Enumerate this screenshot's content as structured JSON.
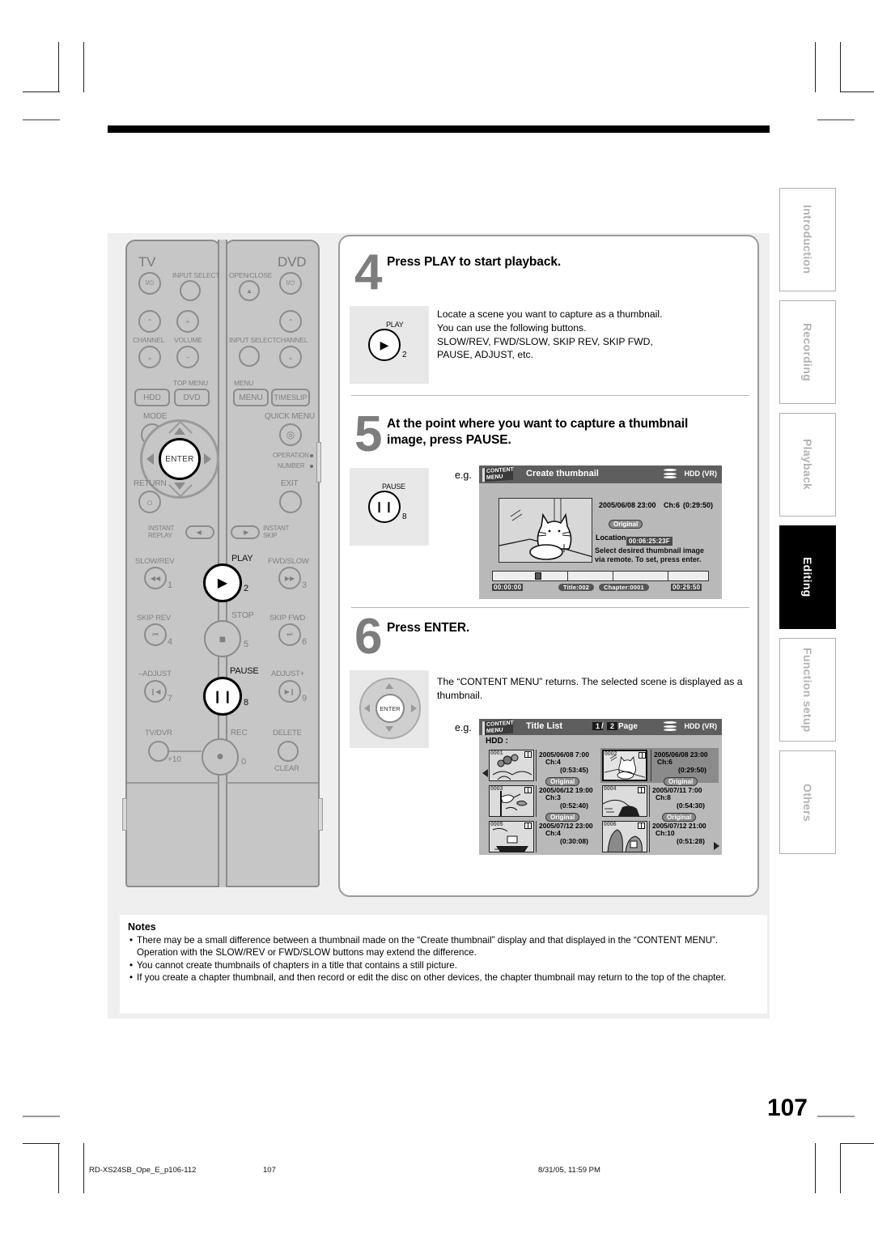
{
  "page": {
    "number": "107",
    "footer_file": "RD-XS24SB_Ope_E_p106-112",
    "footer_page": "107",
    "footer_date": "8/31/05, 11:59 PM"
  },
  "side_tabs": [
    {
      "label": "Introduction",
      "active": false
    },
    {
      "label": "Recording",
      "active": false
    },
    {
      "label": "Playback",
      "active": false
    },
    {
      "label": "Editing",
      "active": true
    },
    {
      "label": "Function setup",
      "active": false
    },
    {
      "label": "Others",
      "active": false
    }
  ],
  "steps": [
    {
      "number": "4",
      "heading": "Press PLAY to start playback.",
      "key_label": "PLAY",
      "key_number": "2",
      "key_icon": "play-icon",
      "body": "Locate a scene you want to capture as a thumbnail.\nYou can use the following buttons.\nSLOW/REV, FWD/SLOW, SKIP REV, SKIP FWD,\nPAUSE, ADJUST, etc."
    },
    {
      "number": "5",
      "heading": "At the point where you want to capture a thumbnail image, press PAUSE.",
      "key_label": "PAUSE",
      "key_number": "8",
      "key_icon": "pause-icon",
      "eg": "e.g."
    },
    {
      "number": "6",
      "heading": "Press ENTER.",
      "key_label": "ENTER",
      "key_icon": "dpad-enter-icon",
      "body": "The “CONTENT MENU” returns. The selected scene is displayed as a thumbnail.",
      "eg": "e.g."
    }
  ],
  "screen_create_thumbnail": {
    "logo": "CONTENT MENU",
    "title": "Create thumbnail",
    "media": "HDD (VR)",
    "info_date": "2005/06/08 23:00",
    "info_channel": "Ch:6",
    "info_duration": "(0:29:50)",
    "chip_original": "Original",
    "location_label": "Location",
    "location_value": "00:06:25:23F",
    "hint": "Select desired thumbnail image via remote. To set, press enter.",
    "progress_start": "00:00:00",
    "progress_end": "00:29:50",
    "progress_title": "Title:002",
    "progress_chapter": "Chapter:0001"
  },
  "screen_title_list": {
    "logo": "CONTENT MENU",
    "title": "Title List",
    "page_current": "1",
    "page_total": "2",
    "page_label": "Page",
    "media": "HDD (VR)",
    "source": "HDD :",
    "items": [
      {
        "no": "0001",
        "date": "2005/06/08  7:00",
        "channel": "Ch:4",
        "duration": "(0:53:45)",
        "chip": "Original",
        "selected": false
      },
      {
        "no": "0002",
        "date": "2005/06/08 23:00",
        "channel": "Ch:6",
        "duration": "(0:29:50)",
        "chip": "Original",
        "selected": true
      },
      {
        "no": "0003",
        "date": "2005/06/12 19:00",
        "channel": "Ch:3",
        "duration": "(0:52:40)",
        "chip": "Original",
        "selected": false
      },
      {
        "no": "0004",
        "date": "2005/07/11  7:00",
        "channel": "Ch:8",
        "duration": "(0:54:30)",
        "chip": "Original",
        "selected": false
      },
      {
        "no": "0005",
        "date": "2005/07/12 23:00",
        "channel": "Ch:4",
        "duration": "(0:30:08)",
        "chip": "",
        "selected": false
      },
      {
        "no": "0006",
        "date": "2005/07/12 21:00",
        "channel": "Ch:10",
        "duration": "(0:51:28)",
        "chip": "",
        "selected": false
      }
    ]
  },
  "notes": {
    "title": "Notes",
    "items": [
      "There may be a small difference between a thumbnail made on the “Create thumbnail” display and that displayed in the “CONTENT MENU”. Operation with the SLOW/REV or FWD/SLOW buttons may extend the difference.",
      "You cannot create thumbnails of chapters in a title that contains a still picture.",
      "If you create a chapter thumbnail, and then record or edit the disc on other devices, the chapter thumbnail may return to the top of the chapter."
    ]
  },
  "remote": {
    "section_tv": "TV",
    "section_dvd": "DVD",
    "labels": {
      "input_select_l": "INPUT SELECT",
      "open_close": "OPEN/CLOSE",
      "channel_l": "CHANNEL",
      "volume": "VOLUME",
      "input_select_r": "INPUT SELECT",
      "channel_r": "CHANNEL",
      "top_menu": "TOP MENU",
      "menu": "MENU",
      "hdd": "HDD",
      "dvd_btn": "DVD",
      "menu_btn": "MENU",
      "timeslip": "TIMESLIP",
      "mode": "MODE",
      "quick_menu": "QUICK MENU",
      "operation": "OPERATION",
      "number": "NUMBER",
      "return": "RETURN",
      "exit": "EXIT",
      "enter": "ENTER",
      "instant_replay": "INSTANT\nREPLAY",
      "instant_skip": "INSTANT\nSKIP",
      "slow_rev": "SLOW/REV",
      "play": "PLAY",
      "fwd_slow": "FWD/SLOW",
      "skip_rev": "SKIP REV",
      "stop": "STOP",
      "skip_fwd": "SKIP FWD",
      "adjust_minus": "–ADJUST",
      "pause": "PAUSE",
      "adjust_plus": "ADJUST+",
      "tv_dvr": "TV/DVR",
      "rec": "REC",
      "delete": "DELETE",
      "clear": "CLEAR",
      "plus10": "+10"
    },
    "numbers": {
      "n1": "1",
      "n2": "2",
      "n3": "3",
      "n4": "4",
      "n5": "5",
      "n6": "6",
      "n7": "7",
      "n8": "8",
      "n9": "9",
      "n0": "0"
    }
  }
}
